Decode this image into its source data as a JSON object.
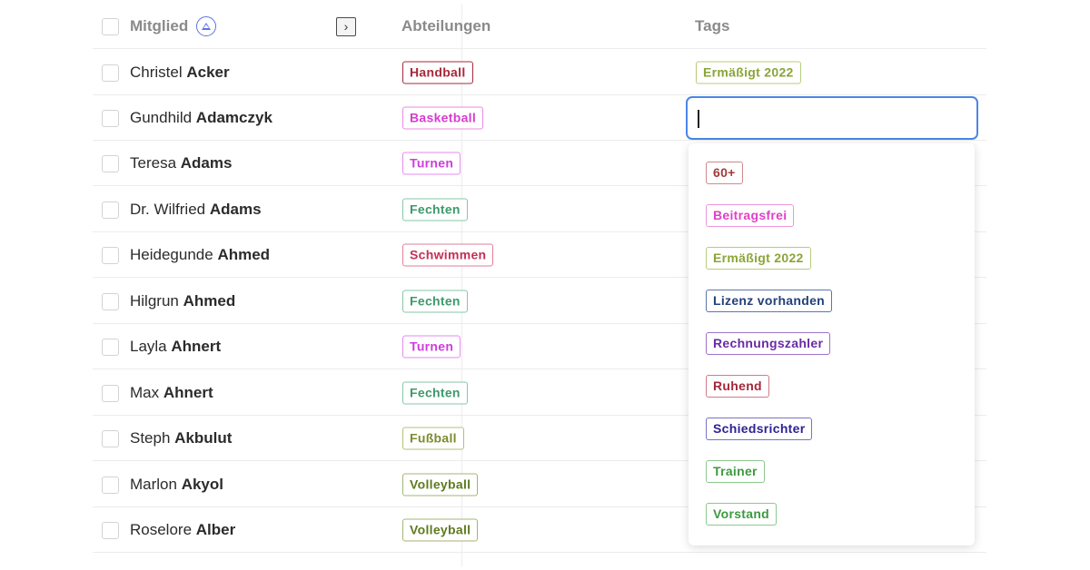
{
  "header": {
    "member_label": "Mitglied",
    "departments_label": "Abteilungen",
    "tags_label": "Tags"
  },
  "icons": {
    "sort": "sort-ascending-icon",
    "expand": "chevron-right-icon"
  },
  "colors": {
    "handball": "#a7283a",
    "basketball": "#d63ccf",
    "turnen": "#cf3ce0",
    "fechten": "#3d9a6a",
    "schwimmen": "#c52f55",
    "fussball": "#7d8a2c",
    "volleyball": "#5e7a1f",
    "ermaessigt": "#8aa538",
    "sixty_plus": "#a33a3a",
    "beitragsfrei": "#e040c8",
    "lizenz": "#23417a",
    "rechnungszahler": "#6a2aa8",
    "ruhend": "#a3283a",
    "schiedsrichter": "#2d2294",
    "trainer": "#3d9a3f",
    "vorstand": "#3d9a3f",
    "input_focus": "#4a86e8"
  },
  "rows": [
    {
      "first": "Christel",
      "last": "Acker",
      "department": "Handball",
      "tag": "Ermäßigt 2022"
    },
    {
      "first": "Gundhild",
      "last": "Adamczyk",
      "department": "Basketball",
      "tag": ""
    },
    {
      "first": "Teresa",
      "last": "Adams",
      "department": "Turnen",
      "tag": ""
    },
    {
      "first": "Dr. Wilfried",
      "last": "Adams",
      "department": "Fechten",
      "tag": ""
    },
    {
      "first": "Heidegunde",
      "last": "Ahmed",
      "department": "Schwimmen",
      "tag": ""
    },
    {
      "first": "Hilgrun",
      "last": "Ahmed",
      "department": "Fechten",
      "tag": ""
    },
    {
      "first": "Layla",
      "last": "Ahnert",
      "department": "Turnen",
      "tag": ""
    },
    {
      "first": "Max",
      "last": "Ahnert",
      "department": "Fechten",
      "tag": ""
    },
    {
      "first": "Steph",
      "last": "Akbulut",
      "department": "Fußball",
      "tag": ""
    },
    {
      "first": "Marlon",
      "last": "Akyol",
      "department": "Volleyball",
      "tag": ""
    },
    {
      "first": "Roselore",
      "last": "Alber",
      "department": "Volleyball",
      "tag": ""
    }
  ],
  "tag_input": {
    "value": ""
  },
  "dropdown_options": [
    "60+",
    "Beitragsfrei",
    "Ermäßigt 2022",
    "Lizenz vorhanden",
    "Rechnungszahler",
    "Ruhend",
    "Schiedsrichter",
    "Trainer",
    "Vorstand"
  ]
}
